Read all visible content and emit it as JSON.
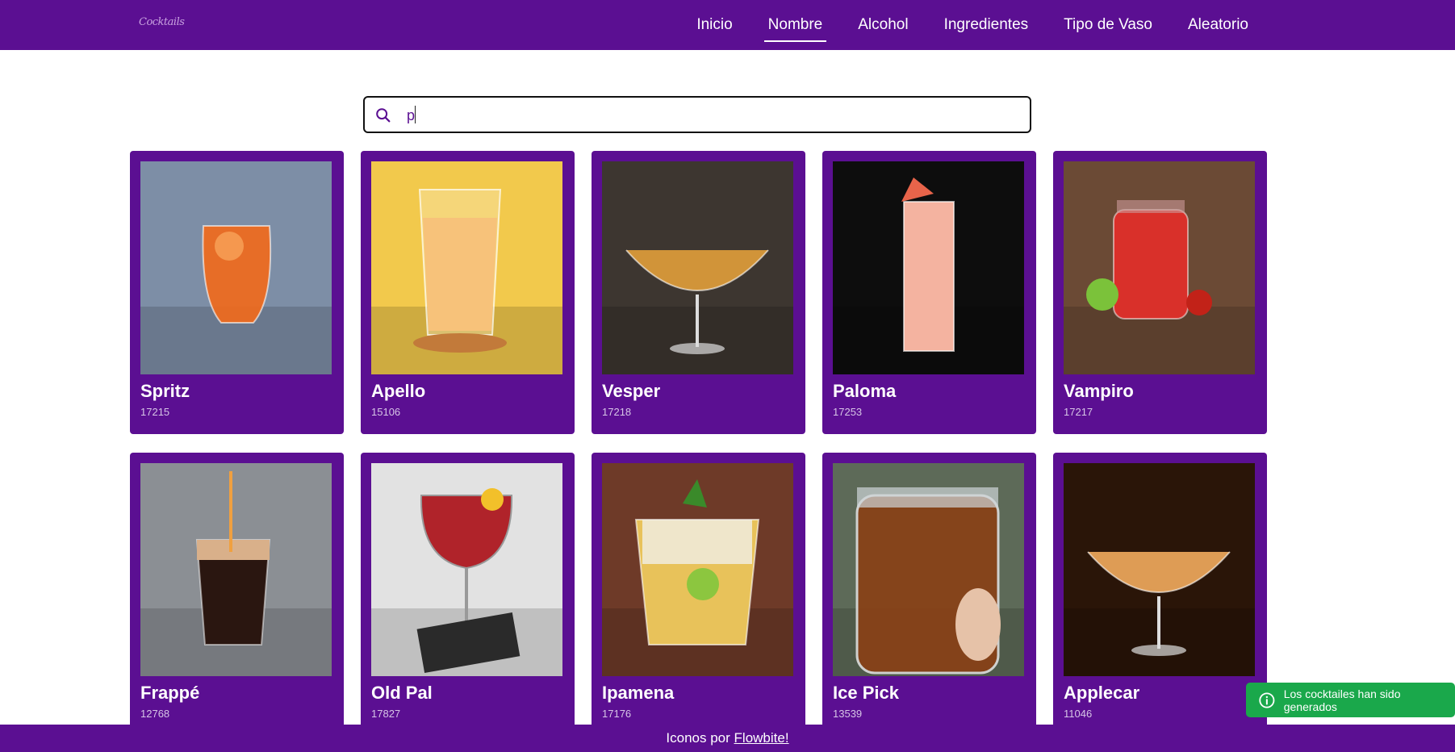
{
  "header": {
    "logo": "Cocktails",
    "nav": [
      {
        "label": "Inicio",
        "active": false
      },
      {
        "label": "Nombre",
        "active": true
      },
      {
        "label": "Alcohol",
        "active": false
      },
      {
        "label": "Ingredientes",
        "active": false
      },
      {
        "label": "Tipo de Vaso",
        "active": false
      },
      {
        "label": "Aleatorio",
        "active": false
      }
    ]
  },
  "search": {
    "value": "p",
    "icon": "search-icon"
  },
  "cocktails": [
    {
      "name": "Spritz",
      "id": "17215",
      "bg": "#7d8ea6",
      "drink": "#f06a1c",
      "glass": "tumbler"
    },
    {
      "name": "Apello",
      "id": "15106",
      "bg": "#f2c94c",
      "drink": "#f7c27a",
      "glass": "highball"
    },
    {
      "name": "Vesper",
      "id": "17218",
      "bg": "#3d3630",
      "drink": "#d99a3a",
      "glass": "coupe"
    },
    {
      "name": "Paloma",
      "id": "17253",
      "bg": "#0d0d0d",
      "drink": "#f4b3a0",
      "glass": "collins"
    },
    {
      "name": "Vampiro",
      "id": "17217",
      "bg": "#6b4a35",
      "drink": "#d9302a",
      "glass": "jar"
    },
    {
      "name": "Frappé",
      "id": "12768",
      "bg": "#8b8f94",
      "drink": "#2a1610",
      "glass": "pint"
    },
    {
      "name": "Old Pal",
      "id": "17827",
      "bg": "#e2e2e2",
      "drink": "#b0232a",
      "glass": "wine"
    },
    {
      "name": "Ipamena",
      "id": "17176",
      "bg": "#6e3a28",
      "drink": "#e8c25a",
      "glass": "rocks"
    },
    {
      "name": "Ice Pick",
      "id": "13539",
      "bg": "#5d6a58",
      "drink": "#8a4015",
      "glass": "mason"
    },
    {
      "name": "Applecar",
      "id": "11046",
      "bg": "#2a1508",
      "drink": "#e8a35a",
      "glass": "coupe"
    }
  ],
  "footer": {
    "text": "Iconos por ",
    "link": "Flowbite!"
  },
  "toast": {
    "message": "Los cocktailes han sido generados",
    "icon": "info-icon",
    "color": "#1aa84b"
  },
  "colors": {
    "brand": "#5b0f92"
  }
}
